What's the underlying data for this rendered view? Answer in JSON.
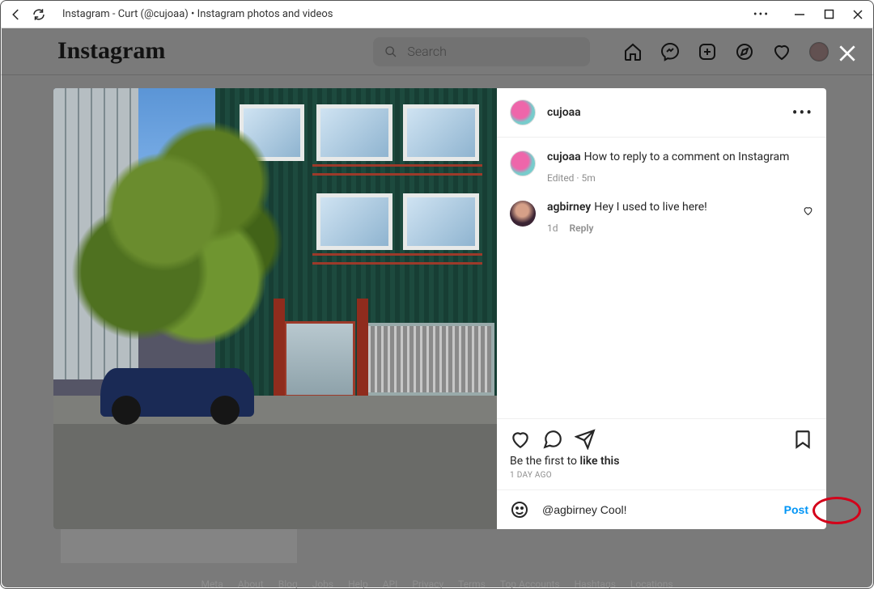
{
  "chrome": {
    "tab_title": "Instagram - Curt (@cujoaa) • Instagram photos and videos"
  },
  "header": {
    "logo_text": "Instagram",
    "search_placeholder": "Search"
  },
  "post": {
    "owner": "cujoaa",
    "caption_user": "cujoaa",
    "caption_text": "How to reply to a comment on Instagram",
    "caption_meta": "Edited · 5m",
    "likes_prefix": "Be the first to ",
    "likes_action": "like this",
    "timestamp": "1 DAY AGO"
  },
  "comments": [
    {
      "user": "agbirney",
      "text": "Hey I used to live here!",
      "age": "1d",
      "reply_label": "Reply"
    }
  ],
  "compose": {
    "value": "@agbirney Cool!",
    "post_label": "Post"
  },
  "footer": [
    "Meta",
    "About",
    "Blog",
    "Jobs",
    "Help",
    "API",
    "Privacy",
    "Terms",
    "Top Accounts",
    "Hashtags",
    "Locations"
  ]
}
